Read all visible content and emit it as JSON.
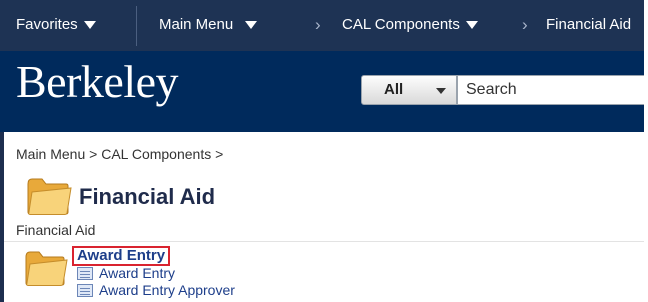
{
  "nav": {
    "favorites": "Favorites",
    "main_menu": "Main Menu",
    "cal_components": "CAL Components",
    "financial_aid": "Financial Aid"
  },
  "header": {
    "logo": "Berkeley",
    "scope_label": "All",
    "search_placeholder": "Search"
  },
  "content": {
    "breadcrumb": {
      "main_menu": "Main Menu",
      "cal_components": "CAL Components",
      "separator": ">"
    },
    "title": "Financial Aid",
    "subtitle": "Financial Aid",
    "section": {
      "label": "Award Entry",
      "items": [
        "Award Entry",
        "Award Entry Approver"
      ]
    }
  },
  "colors": {
    "nav_bg": "#1e3354",
    "header_bg": "#002a5c",
    "link": "#1d3e8a",
    "highlight_border": "#d9232f"
  }
}
